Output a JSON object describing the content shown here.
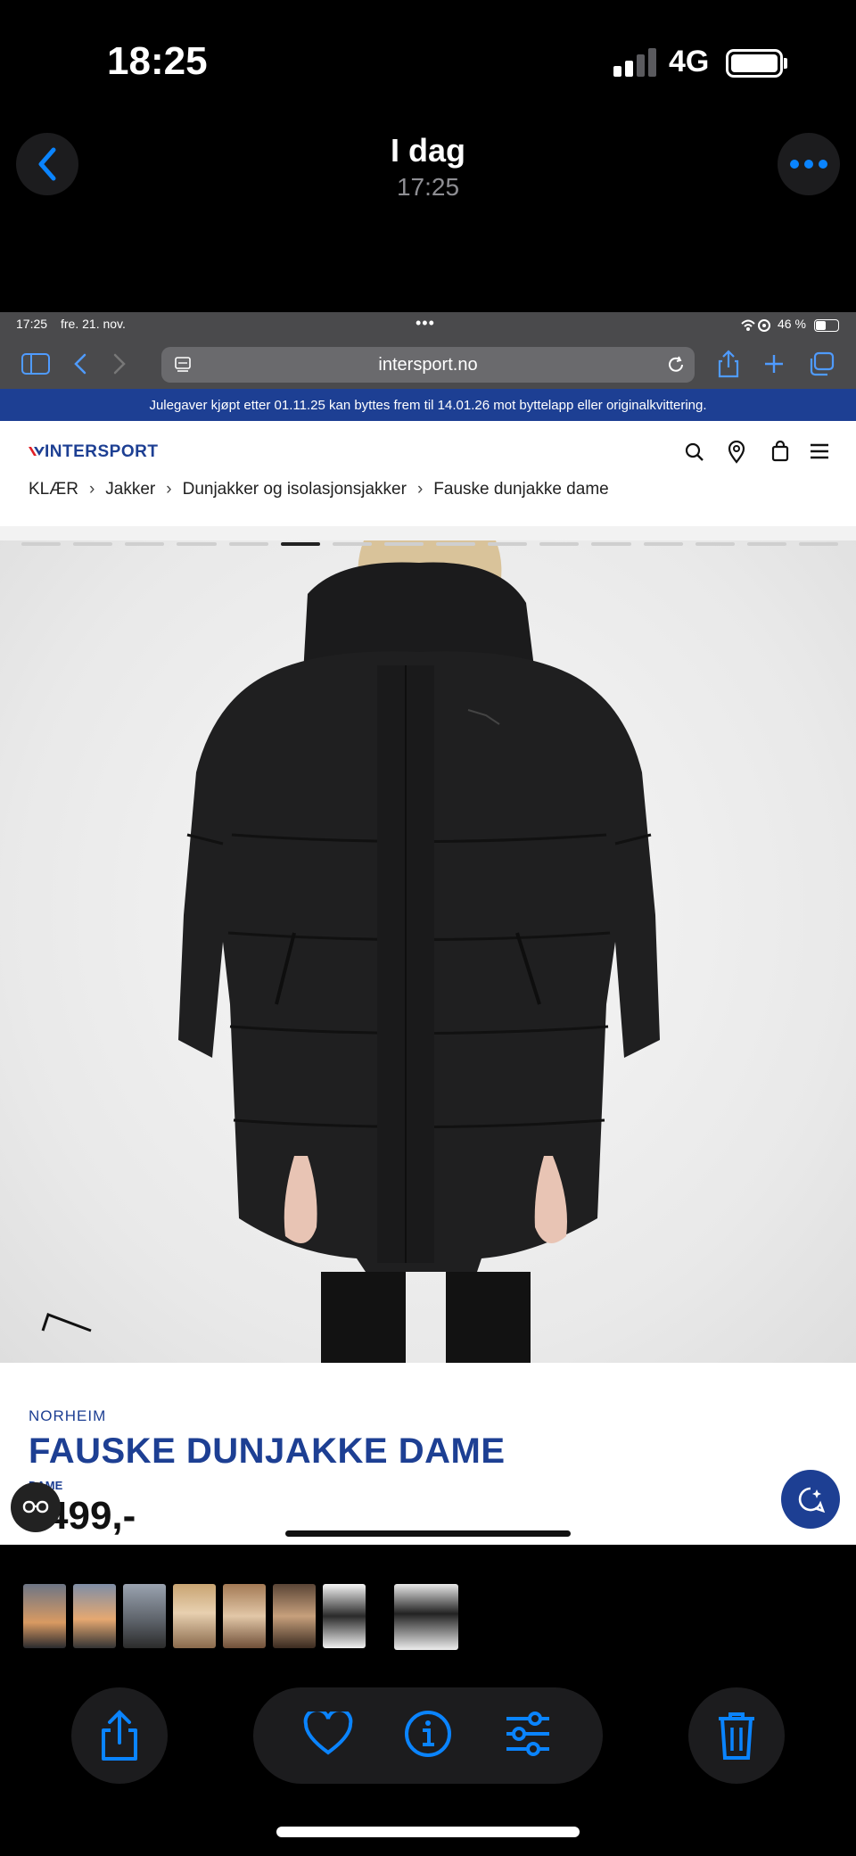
{
  "ios_status": {
    "time": "18:25",
    "network": "4G"
  },
  "photos_header": {
    "title": "I dag",
    "subtitle": "17:25"
  },
  "ipad_status": {
    "time": "17:25",
    "date": "fre. 21. nov.",
    "battery": "46 %"
  },
  "safari": {
    "url": "intersport.no"
  },
  "promo_banner": "Julegaver kjøpt etter 01.11.25 kan byttes frem til 14.01.26 mot byttelapp eller originalkvittering.",
  "site": {
    "logo": "INTERSPORT",
    "breadcrumbs": [
      "KLÆR",
      "Jakker",
      "Dunjakker og isolasjonsjakker",
      "Fauske dunjakke dame"
    ],
    "gallery_active_index": 5,
    "gallery_count": 16,
    "brand_logo": "norheim"
  },
  "product": {
    "brand": "NORHEIM",
    "name": "FAUSKE DUNJAKKE DAME",
    "category": "DAME",
    "price": "499,-"
  },
  "icons": {
    "back": "chevron-left-icon",
    "more": "ellipsis-icon",
    "share": "share-icon",
    "favorite": "heart-icon",
    "info": "info-icon",
    "adjust": "sliders-icon",
    "delete": "trash-icon"
  },
  "colors": {
    "accent": "#0a84ff",
    "brand_blue": "#1d3f93",
    "brand_red": "#e11f26"
  }
}
